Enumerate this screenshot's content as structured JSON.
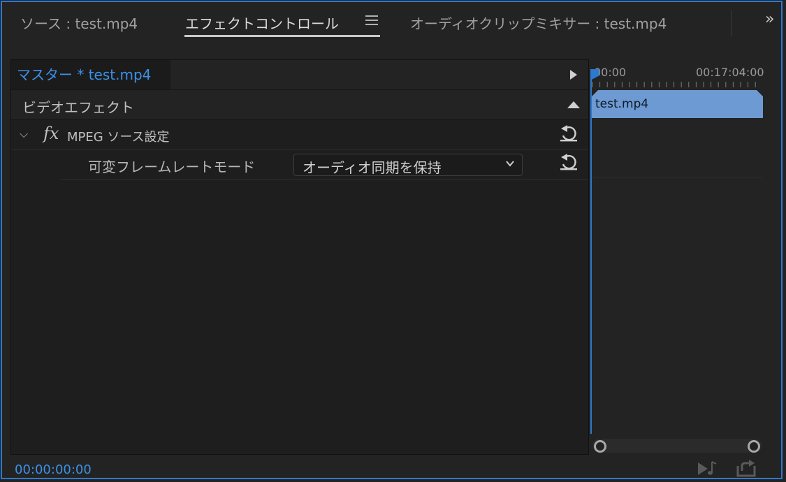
{
  "tabs": {
    "source": "ソース : test.mp4",
    "effect_controls": "エフェクトコントロール",
    "audio_mixer": "オーディオクリップミキサー : test.mp4",
    "overflow": "»"
  },
  "panel": {
    "clip_title": "マスター * test.mp4",
    "section": "ビデオエフェクト",
    "effect": {
      "fx_icon": "fx",
      "name": "MPEG ソース設定"
    },
    "property": {
      "label": "可変フレームレートモード",
      "value": "オーディオ同期を保持"
    }
  },
  "timeline": {
    "start_time": "00:00",
    "end_time": "00:17:04:00",
    "clip_label": "test.mp4"
  },
  "footer": {
    "timecode": "00:00:00:00"
  },
  "colors": {
    "accent": "#2d79cf",
    "timecode_text": "#3b92e8",
    "clip_bar": "#6d9ad2",
    "background": "#232323"
  }
}
